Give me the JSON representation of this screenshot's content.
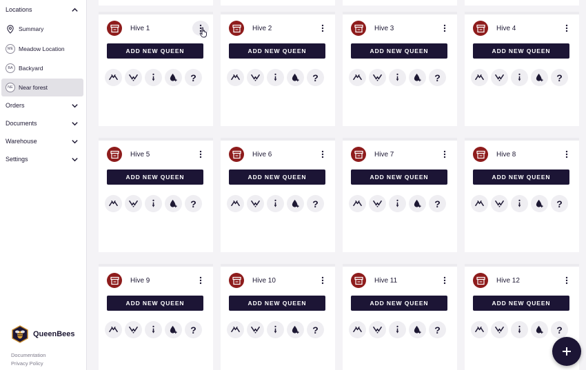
{
  "sidebar": {
    "sections": [
      {
        "label": "Locations",
        "expanded": true
      },
      {
        "label": "Orders",
        "expanded": false
      },
      {
        "label": "Documents",
        "expanded": false
      },
      {
        "label": "Warehouse",
        "expanded": false
      },
      {
        "label": "Settings",
        "expanded": false
      }
    ],
    "locations": [
      {
        "label": "Summary",
        "badge": null,
        "icon": "map-pin-icon"
      },
      {
        "label": "Meadow Location",
        "badge": "ME"
      },
      {
        "label": "Backyard",
        "badge": "BA"
      },
      {
        "label": "Near forest",
        "badge": "NE",
        "active": true
      }
    ],
    "brand": "QueenBees",
    "footer_links": [
      "Documentation",
      "Privacy Policy"
    ]
  },
  "hives": [
    {
      "name": "Hive 1"
    },
    {
      "name": "Hive 2"
    },
    {
      "name": "Hive 3"
    },
    {
      "name": "Hive 4"
    },
    {
      "name": "Hive 5"
    },
    {
      "name": "Hive 6"
    },
    {
      "name": "Hive 7"
    },
    {
      "name": "Hive 8"
    },
    {
      "name": "Hive 9"
    },
    {
      "name": "Hive 10"
    },
    {
      "name": "Hive 11"
    },
    {
      "name": "Hive 12"
    }
  ],
  "card": {
    "add_button_label": "ADD NEW QUEEN",
    "actions": [
      "merge-icon",
      "split-icon",
      "drip-icon",
      "feed-icon",
      "help-icon"
    ],
    "help_label": "?"
  },
  "colors": {
    "accent": "#1c1535",
    "hive": "#8e1c1c"
  },
  "fab_label": "+"
}
